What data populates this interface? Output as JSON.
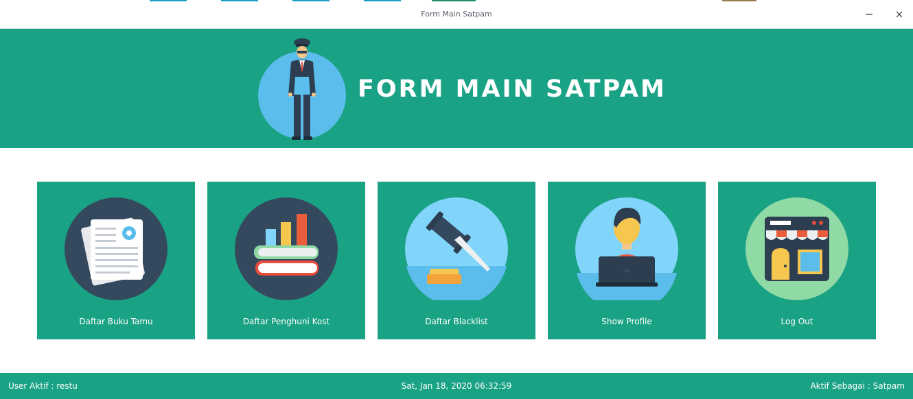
{
  "window": {
    "title": "Form Main Satpam",
    "minimize_icon": "minimize-icon",
    "close_icon": "close-icon"
  },
  "header": {
    "heading": "FORM MAIN SATPAM",
    "avatar_icon": "security-guard-icon"
  },
  "menu": {
    "items": [
      {
        "label": "Daftar Buku Tamu",
        "icon": "guestbook-document-icon"
      },
      {
        "label": "Daftar Penghuni Kost",
        "icon": "books-chart-icon"
      },
      {
        "label": "Daftar Blacklist",
        "icon": "gavel-icon"
      },
      {
        "label": "Show Profile",
        "icon": "user-laptop-icon"
      },
      {
        "label": "Log Out",
        "icon": "storefront-icon"
      }
    ]
  },
  "status": {
    "user": "User Aktif : restu",
    "datetime": "Sat, Jan 18, 2020 06:32:59",
    "role": "Aktif Sebagai : Satpam"
  },
  "colors": {
    "accent": "#1aa284",
    "dark_circle": "#34495e",
    "light_circle": "#81d4fa",
    "green_circle": "#8fdaa5"
  }
}
